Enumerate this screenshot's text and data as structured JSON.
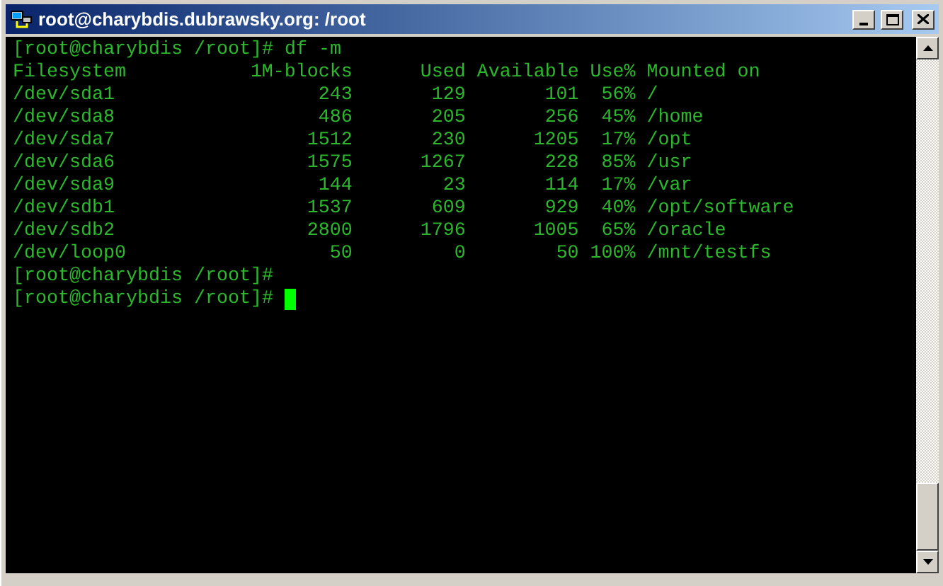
{
  "window": {
    "title": "root@charybdis.dubrawsky.org: /root"
  },
  "terminal": {
    "command_line": {
      "prompt": "[root@charybdis /root]#",
      "command": "df -m"
    },
    "df_table": {
      "columns": [
        "Filesystem",
        "1M-blocks",
        "Used",
        "Available",
        "Use%",
        "Mounted on"
      ],
      "rows": [
        [
          "/dev/sda1",
          "243",
          "129",
          "101",
          "56%",
          "/"
        ],
        [
          "/dev/sda8",
          "486",
          "205",
          "256",
          "45%",
          "/home"
        ],
        [
          "/dev/sda7",
          "1512",
          "230",
          "1205",
          "17%",
          "/opt"
        ],
        [
          "/dev/sda6",
          "1575",
          "1267",
          "228",
          "85%",
          "/usr"
        ],
        [
          "/dev/sda9",
          "144",
          "23",
          "114",
          "17%",
          "/var"
        ],
        [
          "/dev/sdb1",
          "1537",
          "609",
          "929",
          "40%",
          "/opt/software"
        ],
        [
          "/dev/sdb2",
          "2800",
          "1796",
          "1005",
          "65%",
          "/oracle"
        ],
        [
          "/dev/loop0",
          "50",
          "0",
          "50",
          "100%",
          "/mnt/testfs"
        ]
      ]
    },
    "prompts": [
      {
        "prompt": "[root@charybdis /root]#",
        "cursor": false
      },
      {
        "prompt": "[root@charybdis /root]#",
        "cursor": true
      }
    ]
  }
}
